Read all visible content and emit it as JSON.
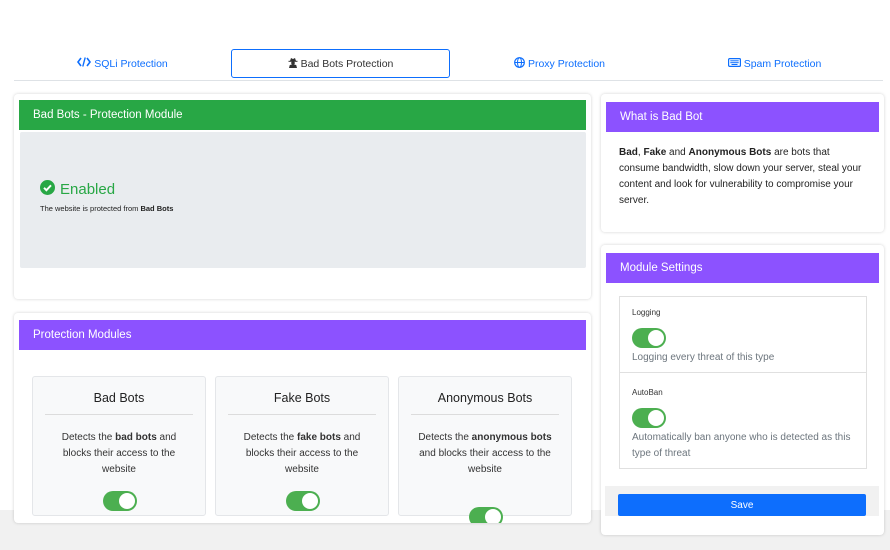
{
  "tabs": [
    {
      "label": "SQLi Protection",
      "icon": "code-icon",
      "active": false
    },
    {
      "label": "Bad Bots Protection",
      "icon": "user-secret-icon",
      "active": true
    },
    {
      "label": "Proxy Protection",
      "icon": "globe-icon",
      "active": false
    },
    {
      "label": "Spam Protection",
      "icon": "keyboard-icon",
      "active": false
    }
  ],
  "status_card": {
    "title": "Bad Bots - Protection Module",
    "status": "Enabled",
    "desc_prefix": "The website is protected from ",
    "desc_bold": "Bad Bots"
  },
  "modules_card": {
    "title": "Protection Modules",
    "modules": [
      {
        "title": "Bad Bots",
        "pre": "Detects the ",
        "bold": "bad bots",
        "post": " and blocks their access to the website",
        "enabled": true
      },
      {
        "title": "Fake Bots",
        "pre": "Detects the ",
        "bold": "fake bots",
        "post": " and blocks their access to the website",
        "enabled": true
      },
      {
        "title": "Anonymous Bots",
        "pre": "Detects the ",
        "bold": "anonymous bots",
        "post": " and blocks their access to the website",
        "enabled": true
      }
    ]
  },
  "info_card": {
    "title": "What is Bad Bot",
    "b1": "Bad",
    "t1": ", ",
    "b2": "Fake",
    "t2": " and ",
    "b3": "Anonymous Bots",
    "t3": " are bots that consume bandwidth, slow down your server, steal your content and look for vulnerability to compromise your server."
  },
  "settings_card": {
    "title": "Module Settings",
    "logging_label": "Logging",
    "logging_desc": "Logging every threat of this type",
    "logging_on": true,
    "autoban_label": "AutoBan",
    "autoban_desc": "Automatically ban anyone who is detected as this type of threat",
    "autoban_on": true,
    "save_label": "Save"
  },
  "colors": {
    "link": "#0d6efd",
    "success": "#28a745",
    "purple": "#8c52ff",
    "toggle": "#4caf50"
  }
}
